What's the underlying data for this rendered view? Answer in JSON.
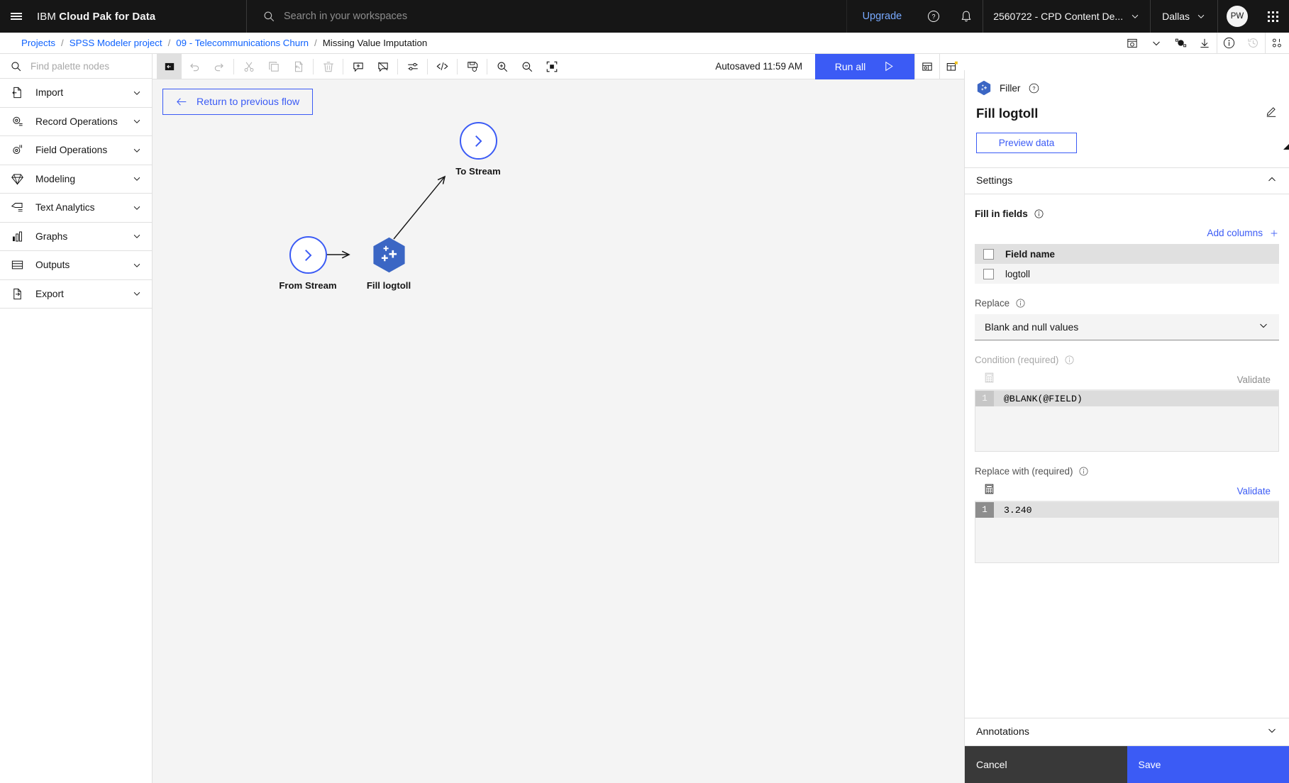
{
  "header": {
    "menu_icon": "hamburger-icon",
    "brand_prefix": "IBM",
    "brand_name": "Cloud Pak for Data",
    "search_placeholder": "Search in your workspaces",
    "search_value": "",
    "upgrade_label": "Upgrade",
    "help_icon": "help-icon",
    "notifications_icon": "bell-icon",
    "account_label": "2560722 - CPD Content De...",
    "region_label": "Dallas",
    "avatar_initials": "PW",
    "app_switcher_icon": "waffle-icon"
  },
  "breadcrumb": {
    "items": [
      {
        "label": "Projects",
        "link": true
      },
      {
        "label": "SPSS Modeler project",
        "link": true
      },
      {
        "label": "09 - Telecommunications Churn",
        "link": true
      },
      {
        "label": "Missing Value Imputation",
        "link": false
      }
    ],
    "separator": "/",
    "actions": [
      {
        "name": "add-to-project-icon"
      },
      {
        "name": "chevron-down-icon"
      },
      {
        "name": "model-management-icon"
      },
      {
        "name": "download-icon"
      },
      {
        "name": "information-icon"
      },
      {
        "name": "history-icon"
      },
      {
        "name": "binary-icon"
      }
    ]
  },
  "palette": {
    "search_placeholder": "Find palette nodes",
    "search_value": "",
    "search_icon": "search-icon",
    "items": [
      {
        "label": "Import",
        "icon": "import-icon"
      },
      {
        "label": "Record Operations",
        "icon": "record-operations-icon"
      },
      {
        "label": "Field Operations",
        "icon": "field-operations-icon"
      },
      {
        "label": "Modeling",
        "icon": "modeling-icon"
      },
      {
        "label": "Text Analytics",
        "icon": "text-analytics-icon"
      },
      {
        "label": "Graphs",
        "icon": "graphs-icon"
      },
      {
        "label": "Outputs",
        "icon": "outputs-icon"
      },
      {
        "label": "Export",
        "icon": "export-icon"
      }
    ]
  },
  "toolbar": {
    "items": [
      {
        "name": "toggle-palette-button",
        "icon": "panel-collapse-icon",
        "state": "active"
      },
      {
        "name": "undo-button",
        "icon": "undo-icon",
        "state": "disabled"
      },
      {
        "name": "redo-button",
        "icon": "redo-icon",
        "state": "disabled"
      },
      {
        "name": "cut-button",
        "icon": "scissors-icon",
        "state": "disabled"
      },
      {
        "name": "copy-button",
        "icon": "copy-icon",
        "state": "disabled"
      },
      {
        "name": "paste-button",
        "icon": "paste-icon",
        "state": "disabled"
      },
      {
        "name": "delete-button",
        "icon": "trash-icon",
        "state": "disabled"
      },
      {
        "name": "add-comment-button",
        "icon": "comment-add-icon",
        "state": "enabled"
      },
      {
        "name": "hide-comments-button",
        "icon": "comment-hide-icon",
        "state": "enabled"
      },
      {
        "name": "flow-settings-button",
        "icon": "sliders-icon",
        "state": "enabled"
      },
      {
        "name": "code-button",
        "icon": "code-icon",
        "state": "enabled"
      },
      {
        "name": "save-flow-button",
        "icon": "save-check-icon",
        "state": "enabled"
      },
      {
        "name": "zoom-in-button",
        "icon": "zoom-in-icon",
        "state": "enabled"
      },
      {
        "name": "zoom-out-button",
        "icon": "zoom-out-icon",
        "state": "enabled"
      },
      {
        "name": "zoom-to-fit-button",
        "icon": "zoom-fit-icon",
        "state": "enabled"
      }
    ],
    "autosaved_label": "Autosaved 11:59 AM",
    "run_all_label": "Run all",
    "run_icon": "play-icon",
    "right_items": [
      {
        "name": "outputs-panel-button",
        "icon": "outputs-table-icon"
      },
      {
        "name": "notifications-panel-button",
        "icon": "notification-count-icon"
      }
    ]
  },
  "canvas": {
    "return_button_label": "Return to previous flow",
    "return_icon": "arrow-left-icon",
    "nodes": [
      {
        "id": "from-stream",
        "label": "From Stream",
        "shape": "circle"
      },
      {
        "id": "fill-logtoll",
        "label": "Fill logtoll",
        "shape": "hexagon"
      },
      {
        "id": "to-stream",
        "label": "To Stream",
        "shape": "circle"
      }
    ]
  },
  "panel": {
    "node_type": "Filler",
    "node_type_icon": "filler-node-icon",
    "help_icon": "help-circle-icon",
    "title": "Fill logtoll",
    "edit_icon": "edit-pencil-icon",
    "preview_label": "Preview data",
    "settings": {
      "section_label": "Settings",
      "collapse_icon": "chevron-up-icon",
      "fill_in_fields_label": "Fill in fields",
      "info_icon": "info-icon",
      "add_columns_label": "Add columns",
      "add_icon": "plus-icon",
      "table": {
        "columns": [
          "Field name"
        ],
        "rows": [
          [
            "logtoll"
          ]
        ]
      },
      "replace_label": "Replace",
      "replace_value": "Blank and null values",
      "replace_chevron": "chevron-down-icon",
      "condition_label": "Condition (required)",
      "condition_validate_label": "Validate",
      "condition_expression_icon": "expression-builder-icon",
      "condition_line_number": "1",
      "condition_code": "@BLANK(@FIELD)",
      "replace_with_label": "Replace with (required)",
      "replace_with_validate_label": "Validate",
      "replace_with_expression_icon": "expression-builder-icon",
      "replace_with_line_number": "1",
      "replace_with_code": "3.240"
    },
    "annotations_label": "Annotations",
    "annotations_chevron": "chevron-down-icon",
    "cancel_label": "Cancel",
    "save_label": "Save"
  },
  "colors": {
    "brand_blue": "#3b5bf5",
    "link_blue": "#0f62fe",
    "header_black": "#161616",
    "canvas_gray": "#f4f4f4",
    "node_blue": "#3b66c4"
  }
}
